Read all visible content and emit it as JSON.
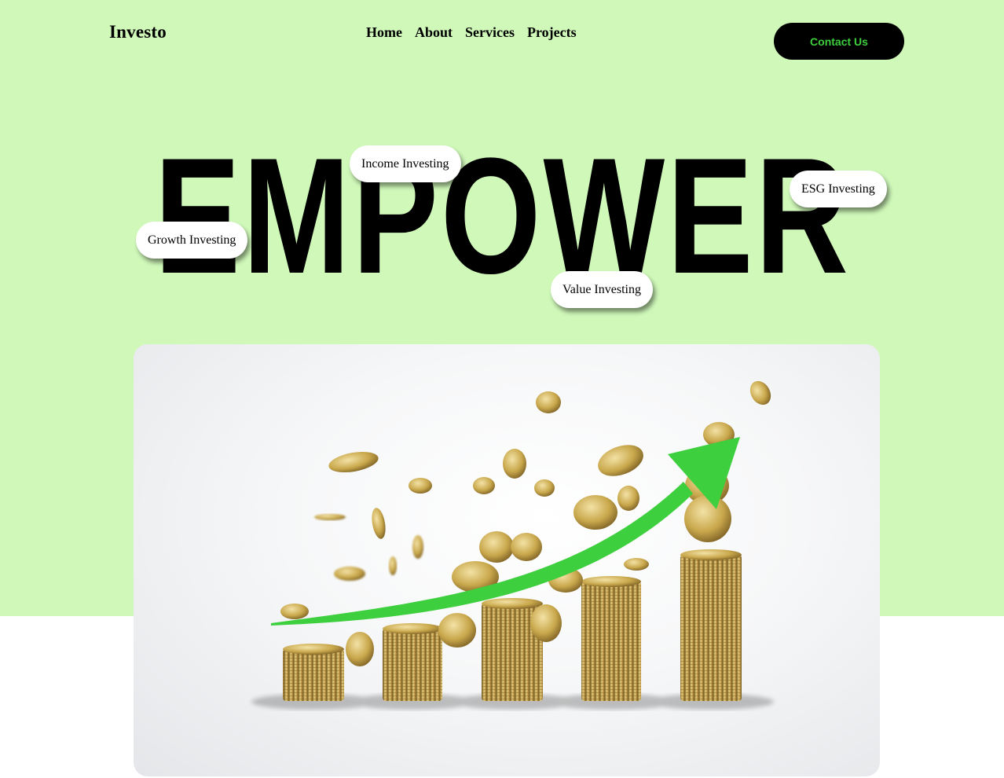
{
  "header": {
    "logo": "Investo",
    "nav": [
      "Home",
      "About",
      "Services",
      "Projects"
    ],
    "contact_label": "Contact Us"
  },
  "hero": {
    "headline": "EMPOWER",
    "tags": {
      "growth": "Growth Investing",
      "income": "Income Investing",
      "value": "Value Investing",
      "esg": "ESG Investing"
    }
  },
  "image": {
    "description_icon": "coin-stacks-growth-arrow-image"
  },
  "colors": {
    "hero_background": "#cff8b9",
    "button_background": "#000000",
    "button_text": "#3ecf3e",
    "arrow": "#3ecf3e",
    "coin": "#c9a84c"
  }
}
